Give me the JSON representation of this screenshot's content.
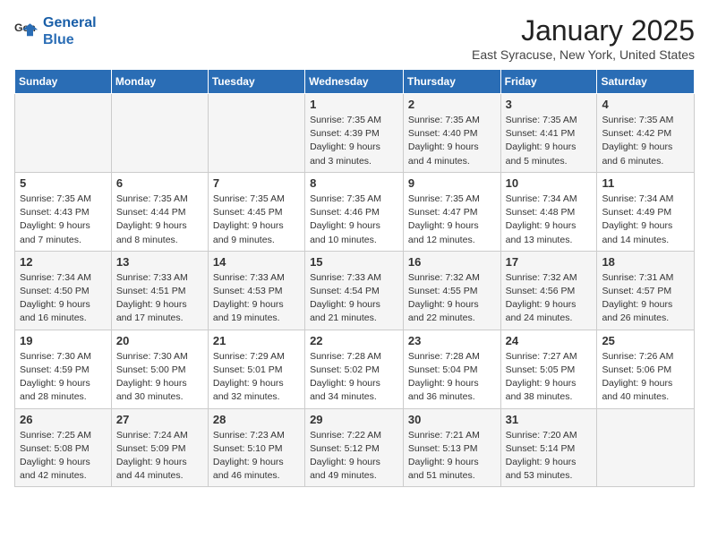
{
  "header": {
    "logo_line1": "General",
    "logo_line2": "Blue",
    "title": "January 2025",
    "location": "East Syracuse, New York, United States"
  },
  "days_of_week": [
    "Sunday",
    "Monday",
    "Tuesday",
    "Wednesday",
    "Thursday",
    "Friday",
    "Saturday"
  ],
  "weeks": [
    [
      {
        "num": "",
        "info": ""
      },
      {
        "num": "",
        "info": ""
      },
      {
        "num": "",
        "info": ""
      },
      {
        "num": "1",
        "info": "Sunrise: 7:35 AM\nSunset: 4:39 PM\nDaylight: 9 hours and 3 minutes."
      },
      {
        "num": "2",
        "info": "Sunrise: 7:35 AM\nSunset: 4:40 PM\nDaylight: 9 hours and 4 minutes."
      },
      {
        "num": "3",
        "info": "Sunrise: 7:35 AM\nSunset: 4:41 PM\nDaylight: 9 hours and 5 minutes."
      },
      {
        "num": "4",
        "info": "Sunrise: 7:35 AM\nSunset: 4:42 PM\nDaylight: 9 hours and 6 minutes."
      }
    ],
    [
      {
        "num": "5",
        "info": "Sunrise: 7:35 AM\nSunset: 4:43 PM\nDaylight: 9 hours and 7 minutes."
      },
      {
        "num": "6",
        "info": "Sunrise: 7:35 AM\nSunset: 4:44 PM\nDaylight: 9 hours and 8 minutes."
      },
      {
        "num": "7",
        "info": "Sunrise: 7:35 AM\nSunset: 4:45 PM\nDaylight: 9 hours and 9 minutes."
      },
      {
        "num": "8",
        "info": "Sunrise: 7:35 AM\nSunset: 4:46 PM\nDaylight: 9 hours and 10 minutes."
      },
      {
        "num": "9",
        "info": "Sunrise: 7:35 AM\nSunset: 4:47 PM\nDaylight: 9 hours and 12 minutes."
      },
      {
        "num": "10",
        "info": "Sunrise: 7:34 AM\nSunset: 4:48 PM\nDaylight: 9 hours and 13 minutes."
      },
      {
        "num": "11",
        "info": "Sunrise: 7:34 AM\nSunset: 4:49 PM\nDaylight: 9 hours and 14 minutes."
      }
    ],
    [
      {
        "num": "12",
        "info": "Sunrise: 7:34 AM\nSunset: 4:50 PM\nDaylight: 9 hours and 16 minutes."
      },
      {
        "num": "13",
        "info": "Sunrise: 7:33 AM\nSunset: 4:51 PM\nDaylight: 9 hours and 17 minutes."
      },
      {
        "num": "14",
        "info": "Sunrise: 7:33 AM\nSunset: 4:53 PM\nDaylight: 9 hours and 19 minutes."
      },
      {
        "num": "15",
        "info": "Sunrise: 7:33 AM\nSunset: 4:54 PM\nDaylight: 9 hours and 21 minutes."
      },
      {
        "num": "16",
        "info": "Sunrise: 7:32 AM\nSunset: 4:55 PM\nDaylight: 9 hours and 22 minutes."
      },
      {
        "num": "17",
        "info": "Sunrise: 7:32 AM\nSunset: 4:56 PM\nDaylight: 9 hours and 24 minutes."
      },
      {
        "num": "18",
        "info": "Sunrise: 7:31 AM\nSunset: 4:57 PM\nDaylight: 9 hours and 26 minutes."
      }
    ],
    [
      {
        "num": "19",
        "info": "Sunrise: 7:30 AM\nSunset: 4:59 PM\nDaylight: 9 hours and 28 minutes."
      },
      {
        "num": "20",
        "info": "Sunrise: 7:30 AM\nSunset: 5:00 PM\nDaylight: 9 hours and 30 minutes."
      },
      {
        "num": "21",
        "info": "Sunrise: 7:29 AM\nSunset: 5:01 PM\nDaylight: 9 hours and 32 minutes."
      },
      {
        "num": "22",
        "info": "Sunrise: 7:28 AM\nSunset: 5:02 PM\nDaylight: 9 hours and 34 minutes."
      },
      {
        "num": "23",
        "info": "Sunrise: 7:28 AM\nSunset: 5:04 PM\nDaylight: 9 hours and 36 minutes."
      },
      {
        "num": "24",
        "info": "Sunrise: 7:27 AM\nSunset: 5:05 PM\nDaylight: 9 hours and 38 minutes."
      },
      {
        "num": "25",
        "info": "Sunrise: 7:26 AM\nSunset: 5:06 PM\nDaylight: 9 hours and 40 minutes."
      }
    ],
    [
      {
        "num": "26",
        "info": "Sunrise: 7:25 AM\nSunset: 5:08 PM\nDaylight: 9 hours and 42 minutes."
      },
      {
        "num": "27",
        "info": "Sunrise: 7:24 AM\nSunset: 5:09 PM\nDaylight: 9 hours and 44 minutes."
      },
      {
        "num": "28",
        "info": "Sunrise: 7:23 AM\nSunset: 5:10 PM\nDaylight: 9 hours and 46 minutes."
      },
      {
        "num": "29",
        "info": "Sunrise: 7:22 AM\nSunset: 5:12 PM\nDaylight: 9 hours and 49 minutes."
      },
      {
        "num": "30",
        "info": "Sunrise: 7:21 AM\nSunset: 5:13 PM\nDaylight: 9 hours and 51 minutes."
      },
      {
        "num": "31",
        "info": "Sunrise: 7:20 AM\nSunset: 5:14 PM\nDaylight: 9 hours and 53 minutes."
      },
      {
        "num": "",
        "info": ""
      }
    ]
  ]
}
